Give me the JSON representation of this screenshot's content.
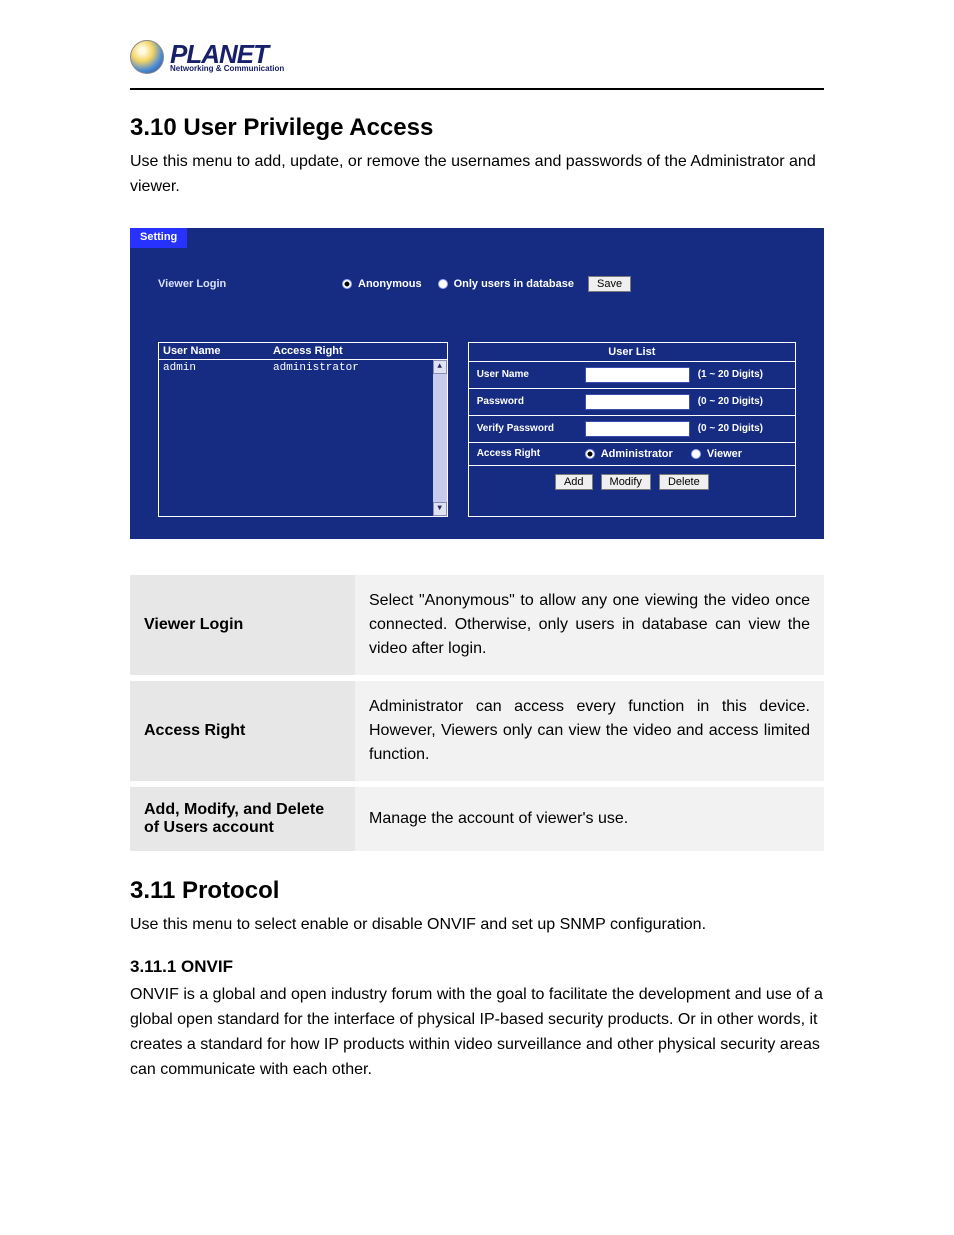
{
  "logo": {
    "main": "PLANET",
    "sub": "Networking & Communication"
  },
  "section1": {
    "heading": "3.10 User Privilege Access",
    "intro": "Use this menu to add, update, or remove the usernames and passwords of the Administrator and viewer."
  },
  "panel": {
    "tab": "Setting",
    "viewer_login_label": "Viewer Login",
    "radio_anonymous": "Anonymous",
    "radio_db": "Only users in database",
    "save": "Save",
    "existing": {
      "col_user": "User Name",
      "col_right": "Access Right",
      "rows": [
        {
          "user": "admin",
          "right": "administrator"
        }
      ]
    },
    "form": {
      "title": "User List",
      "username_label": "User Name",
      "username_hint": "(1 ~ 20 Digits)",
      "password_label": "Password",
      "password_hint": "(0 ~ 20 Digits)",
      "verify_label": "Verify Password",
      "verify_hint": "(0 ~ 20 Digits)",
      "access_label": "Access Right",
      "access_admin": "Administrator",
      "access_viewer": "Viewer",
      "btn_add": "Add",
      "btn_modify": "Modify",
      "btn_delete": "Delete"
    }
  },
  "desc": [
    {
      "key": "Viewer Login",
      "val": "Select \"Anonymous\" to allow any one viewing the video once connected. Otherwise, only users in database can view the video after login."
    },
    {
      "key": "Access Right",
      "val": "Administrator can access every function in this device. However, Viewers only can view the video and access limited function."
    },
    {
      "key": "Add, Modify, and Delete of Users account",
      "val": "Manage the account of viewer's use."
    }
  ],
  "section2": {
    "heading": "3.11 Protocol",
    "intro": "Use this menu to select enable or disable ONVIF and set up SNMP configuration.",
    "sub_heading": "3.11.1 ONVIF",
    "sub_body": "ONVIF is a global and open industry forum with the goal to facilitate the development and use of a global open standard for the interface of physical IP-based security products. Or in other words, it creates a standard for how IP products within video surveillance and other physical security areas can communicate with each other."
  }
}
